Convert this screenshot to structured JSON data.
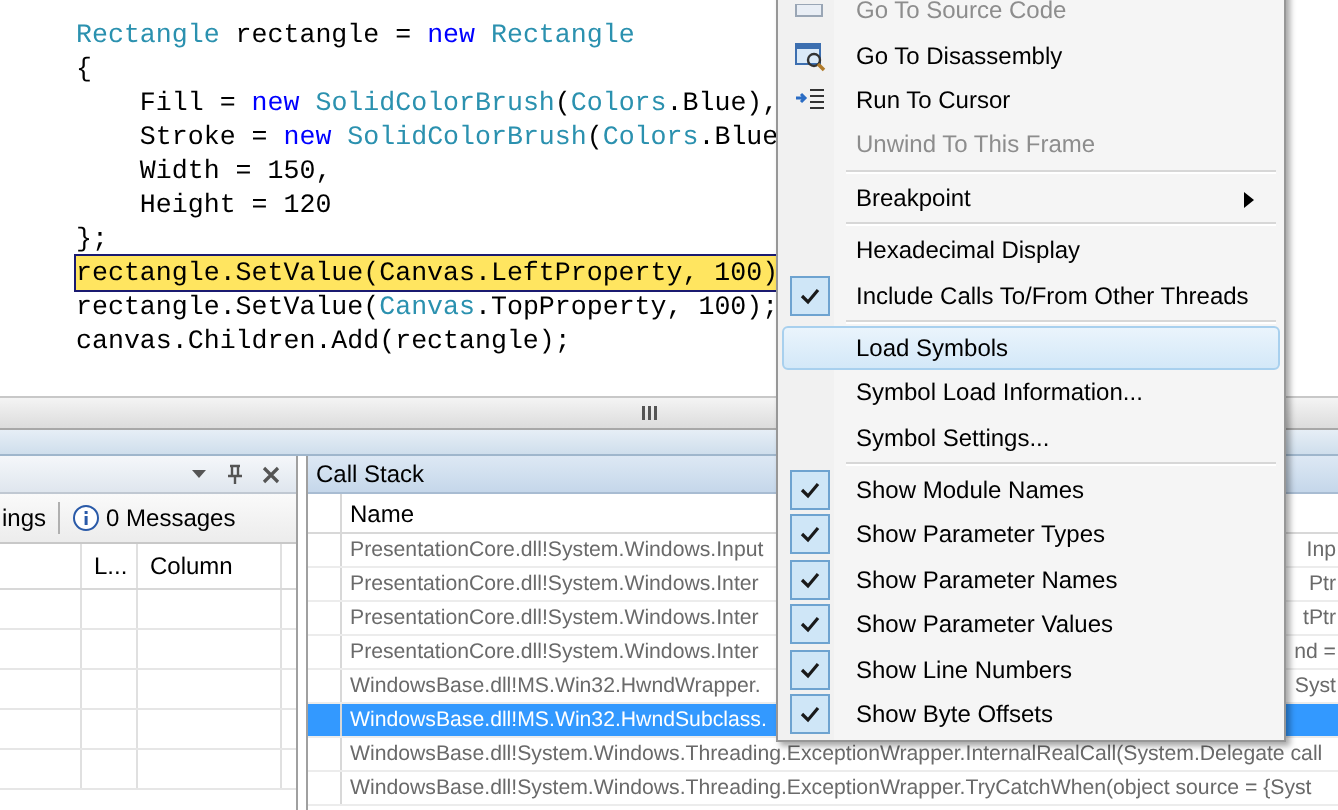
{
  "code_editor": {
    "lines": [
      {
        "highlighted": false,
        "segments": [
          {
            "kind": "type",
            "text": "Rectangle"
          },
          {
            "kind": "plain",
            "text": " rectangle = "
          },
          {
            "kind": "keyword",
            "text": "new"
          },
          {
            "kind": "type",
            "text": " Rectangle"
          }
        ]
      },
      {
        "highlighted": false,
        "segments": [
          {
            "kind": "plain",
            "text": "{"
          }
        ]
      },
      {
        "highlighted": false,
        "segments": [
          {
            "kind": "plain",
            "text": "    Fill = "
          },
          {
            "kind": "keyword",
            "text": "new"
          },
          {
            "kind": "type",
            "text": " SolidColorBrush"
          },
          {
            "kind": "plain",
            "text": "("
          },
          {
            "kind": "type",
            "text": "Colors"
          },
          {
            "kind": "plain",
            "text": ".Blue),"
          }
        ]
      },
      {
        "highlighted": false,
        "segments": [
          {
            "kind": "plain",
            "text": "    Stroke = "
          },
          {
            "kind": "keyword",
            "text": "new"
          },
          {
            "kind": "type",
            "text": " SolidColorBrush"
          },
          {
            "kind": "plain",
            "text": "("
          },
          {
            "kind": "type",
            "text": "Colors"
          },
          {
            "kind": "plain",
            "text": ".Blue"
          }
        ]
      },
      {
        "highlighted": false,
        "segments": [
          {
            "kind": "plain",
            "text": "    Width = 150,"
          }
        ]
      },
      {
        "highlighted": false,
        "segments": [
          {
            "kind": "plain",
            "text": "    Height = 120"
          }
        ]
      },
      {
        "highlighted": false,
        "segments": [
          {
            "kind": "plain",
            "text": "};"
          }
        ]
      },
      {
        "highlighted": true,
        "segments": [
          {
            "kind": "plain",
            "text": "rectangle.SetValue(Canvas.LeftProperty, 100)"
          }
        ]
      },
      {
        "highlighted": false,
        "segments": [
          {
            "kind": "plain",
            "text": "rectangle.SetValue("
          },
          {
            "kind": "type",
            "text": "Canvas"
          },
          {
            "kind": "plain",
            "text": ".TopProperty, 100);"
          }
        ]
      },
      {
        "highlighted": false,
        "segments": [
          {
            "kind": "plain",
            "text": "canvas.Children.Add(rectangle);"
          }
        ]
      }
    ]
  },
  "error_list": {
    "toolbar": {
      "warnings_fragment": "ings",
      "messages": "0 Messages"
    },
    "columns": [
      "L...",
      "Column"
    ]
  },
  "call_stack": {
    "title": "Call Stack",
    "columns": [
      "Name"
    ],
    "rows": [
      {
        "name": "PresentationCore.dll!System.Windows.Input",
        "tail": "Inp",
        "selected": false
      },
      {
        "name": "PresentationCore.dll!System.Windows.Inter",
        "tail": "Ptr",
        "selected": false
      },
      {
        "name": "PresentationCore.dll!System.Windows.Inter",
        "tail": "tPtr",
        "selected": false
      },
      {
        "name": "PresentationCore.dll!System.Windows.Inter",
        "tail": "nd =",
        "selected": false
      },
      {
        "name": "WindowsBase.dll!MS.Win32.HwndWrapper.",
        "tail": "Syst",
        "selected": false
      },
      {
        "name": "WindowsBase.dll!MS.Win32.HwndSubclass.",
        "tail": "",
        "selected": true
      },
      {
        "name": "WindowsBase.dll!System.Windows.Threading.ExceptionWrapper.InternalRealCall(System.Delegate call",
        "tail": "",
        "selected": false
      },
      {
        "name": "WindowsBase.dll!System.Windows.Threading.ExceptionWrapper.TryCatchWhen(object source = {Syst",
        "tail": "",
        "selected": false
      }
    ]
  },
  "context_menu": {
    "items": [
      {
        "kind": "item",
        "label": "Go To Source Code",
        "disabled": true,
        "checked": false,
        "selected": false,
        "submenu": false
      },
      {
        "kind": "item",
        "label": "Go To Disassembly",
        "disabled": false,
        "checked": false,
        "selected": false,
        "submenu": false
      },
      {
        "kind": "item",
        "label": "Run To Cursor",
        "disabled": false,
        "checked": false,
        "selected": false,
        "submenu": false
      },
      {
        "kind": "item",
        "label": "Unwind To This Frame",
        "disabled": true,
        "checked": false,
        "selected": false,
        "submenu": false
      },
      {
        "kind": "separator"
      },
      {
        "kind": "item",
        "label": "Breakpoint",
        "disabled": false,
        "checked": false,
        "selected": false,
        "submenu": true
      },
      {
        "kind": "separator"
      },
      {
        "kind": "item",
        "label": "Hexadecimal Display",
        "disabled": false,
        "checked": false,
        "selected": false,
        "submenu": false
      },
      {
        "kind": "item",
        "label": "Include Calls To/From Other Threads",
        "disabled": false,
        "checked": true,
        "selected": false,
        "submenu": false
      },
      {
        "kind": "separator"
      },
      {
        "kind": "item",
        "label": "Load Symbols",
        "disabled": false,
        "checked": false,
        "selected": true,
        "submenu": false
      },
      {
        "kind": "item",
        "label": "Symbol Load Information...",
        "disabled": false,
        "checked": false,
        "selected": false,
        "submenu": false
      },
      {
        "kind": "item",
        "label": "Symbol Settings...",
        "disabled": false,
        "checked": false,
        "selected": false,
        "submenu": false
      },
      {
        "kind": "separator"
      },
      {
        "kind": "item",
        "label": "Show Module Names",
        "disabled": false,
        "checked": true,
        "selected": false,
        "submenu": false
      },
      {
        "kind": "item",
        "label": "Show Parameter Types",
        "disabled": false,
        "checked": true,
        "selected": false,
        "submenu": false
      },
      {
        "kind": "item",
        "label": "Show Parameter Names",
        "disabled": false,
        "checked": true,
        "selected": false,
        "submenu": false
      },
      {
        "kind": "item",
        "label": "Show Parameter Values",
        "disabled": false,
        "checked": true,
        "selected": false,
        "submenu": false
      },
      {
        "kind": "item",
        "label": "Show Line Numbers",
        "disabled": false,
        "checked": true,
        "selected": false,
        "submenu": false
      },
      {
        "kind": "item",
        "label": "Show Byte Offsets",
        "disabled": false,
        "checked": true,
        "selected": false,
        "submenu": false
      }
    ]
  }
}
